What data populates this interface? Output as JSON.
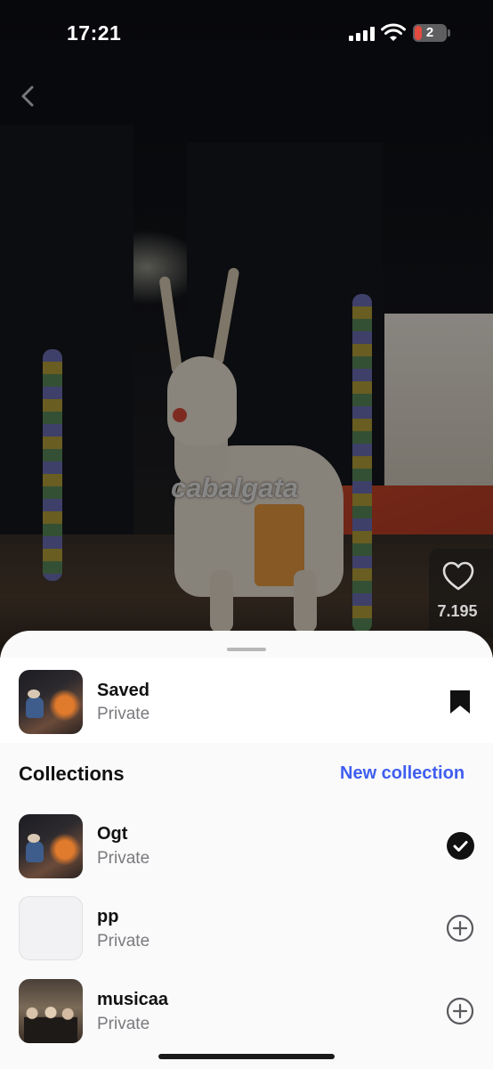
{
  "status_bar": {
    "time": "17:21",
    "battery_level": "2"
  },
  "post": {
    "watermark_text": "cabalgata",
    "like_count": "7.195"
  },
  "sheet": {
    "saved": {
      "title": "Saved",
      "privacy": "Private"
    },
    "collections_heading": "Collections",
    "new_collection_label": "New collection",
    "collections": [
      {
        "name": "Ogt",
        "privacy": "Private",
        "state": "selected"
      },
      {
        "name": "pp",
        "privacy": "Private",
        "state": "add"
      },
      {
        "name": "musicaa",
        "privacy": "Private",
        "state": "add"
      }
    ]
  },
  "icons": {
    "back": "chevron-left-icon",
    "heart": "heart-icon",
    "bookmark": "bookmark-icon",
    "check": "checkmark-circle-icon",
    "add": "plus-circle-icon"
  },
  "colors": {
    "accent": "#3f5ef0",
    "sheet_background": "#fafafa"
  }
}
